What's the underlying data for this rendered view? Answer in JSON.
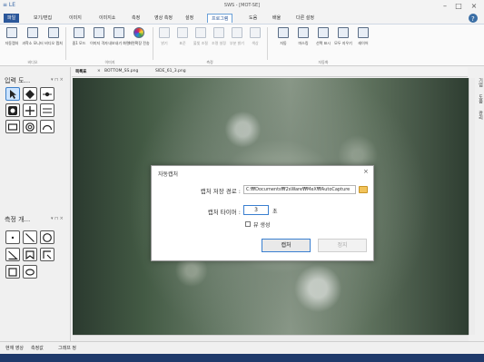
{
  "app": {
    "logo_text": "≡ LE",
    "window_title": "SWS - [MOT-SE]"
  },
  "window_buttons": {
    "minimize": "–",
    "restore": "□",
    "close": "×"
  },
  "menu": {
    "tabs": [
      "파일",
      "보기/편집",
      "이미지",
      "이미지쇼",
      "측정",
      "영상 측정",
      "설정",
      "프로그램",
      "도움",
      "배율",
      "다른 설정"
    ],
    "active": "프로그램"
  },
  "ribbon": {
    "buttons": [
      "자동캡처",
      "과학소 모니터",
      "비디오 캡처",
      "줌1 모드",
      "이미지 격자",
      "내보내기 화면",
      "화면확장 전송",
      "밝기",
      "표준",
      "불빛 조절",
      "조명 설정",
      "부분 밝기",
      "색상",
      "자동",
      "마스킹",
      "선택 표시",
      "모두 지우기",
      "레이어"
    ],
    "groups": [
      "비디오",
      "이미지",
      "측정",
      "자동화"
    ]
  },
  "left_panel": {
    "input_title": "입력 도...",
    "input_ctrl": "▾ ⊓ ×",
    "measure_title": "측정 개...",
    "measure_ctrl": "▾ ⊓ ×"
  },
  "doc_tabs": {
    "close_char": "×",
    "items": [
      "목록표",
      "BOTTOM_SS.png",
      "SIDE_61_3.png"
    ],
    "active": "목록표"
  },
  "right_strip": {
    "labels": [
      "기업",
      "도움",
      "관리"
    ]
  },
  "bottom_tabs": [
    "현재 영상",
    "측정값",
    "그래프 정"
  ],
  "dialog": {
    "title": "자동캡처",
    "close": "×",
    "path_label": "캡처 저장 경로 :",
    "path_value": "C:₩Documents₩2sWare₩MeX₩AutoCapture",
    "timer_label": "캡처 타이머 :",
    "timer_value": "3",
    "timer_unit": "초",
    "preview_label": "뷰 생성",
    "capture_button": "캡처",
    "stop_button": "정지"
  },
  "colors": {
    "file_tab": "#2b579a",
    "accent_border": "#3a7fd0",
    "taskbar": "#1f3a6b",
    "folder": "#f2c35a"
  }
}
